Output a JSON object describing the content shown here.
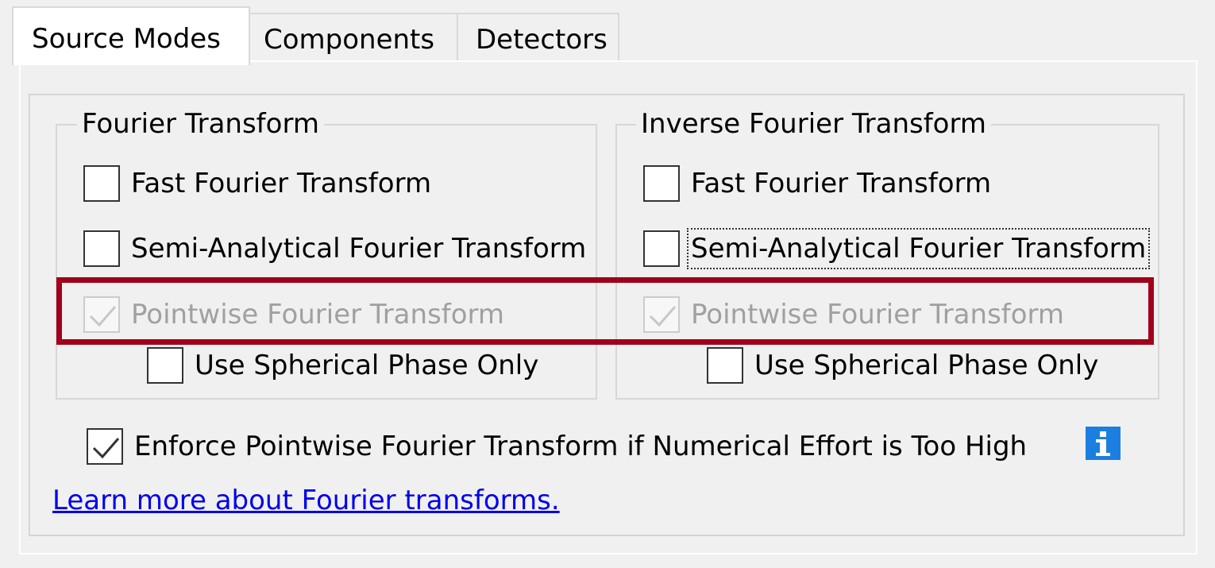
{
  "tabs": [
    {
      "label": "Source Modes",
      "active": true
    },
    {
      "label": "Components",
      "active": false
    },
    {
      "label": "Detectors",
      "active": false
    }
  ],
  "fourier_group": {
    "title": "Fourier Transform",
    "options": {
      "fft": {
        "label": "Fast Fourier Transform",
        "checked": false,
        "enabled": true
      },
      "semi_analytical": {
        "label": "Semi-Analytical Fourier Transform",
        "checked": false,
        "enabled": true
      },
      "pointwise": {
        "label": "Pointwise Fourier Transform",
        "checked": true,
        "enabled": false
      },
      "spherical_phase": {
        "label": "Use Spherical Phase Only",
        "checked": false,
        "enabled": true
      }
    }
  },
  "inverse_group": {
    "title": "Inverse Fourier Transform",
    "options": {
      "fft": {
        "label": "Fast Fourier Transform",
        "checked": false,
        "enabled": true
      },
      "semi_analytical": {
        "label": "Semi-Analytical Fourier Transform",
        "checked": false,
        "enabled": true,
        "focused": true
      },
      "pointwise": {
        "label": "Pointwise Fourier Transform",
        "checked": true,
        "enabled": false
      },
      "spherical_phase": {
        "label": "Use Spherical Phase Only",
        "checked": false,
        "enabled": true
      }
    }
  },
  "enforce": {
    "label": "Enforce Pointwise Fourier Transform if Numerical Effort is Too High",
    "checked": true
  },
  "info_icon": {
    "name": "info-icon",
    "glyph": "i",
    "color": "#1a7fe0"
  },
  "learn_more_link": "Learn more about Fourier transforms.",
  "colors": {
    "highlight": "#a1001a",
    "link": "#0000ee",
    "disabled_text": "#a0a0a0",
    "background": "#f0f0f0"
  }
}
